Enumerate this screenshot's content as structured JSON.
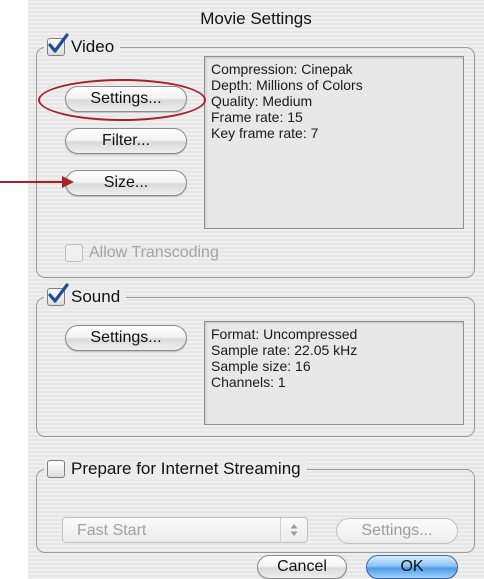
{
  "window": {
    "title": "Movie Settings"
  },
  "video": {
    "checkbox_label": "Video",
    "checked": true,
    "settings_button": "Settings...",
    "filter_button": "Filter...",
    "size_button": "Size...",
    "info_lines": [
      "Compression: Cinepak",
      "Depth: Millions of Colors",
      "Quality: Medium",
      "Frame rate: 15",
      "Key frame rate: 7"
    ],
    "allow_transcoding_label": "Allow Transcoding",
    "allow_transcoding_checked": false
  },
  "sound": {
    "checkbox_label": "Sound",
    "checked": true,
    "settings_button": "Settings...",
    "info_lines": [
      "Format: Uncompressed",
      "Sample rate: 22.05 kHz",
      "Sample size: 16",
      "Channels: 1"
    ]
  },
  "streaming": {
    "checkbox_label": "Prepare for Internet Streaming",
    "checked": false,
    "popup_value": "Fast Start",
    "settings_button": "Settings..."
  },
  "footer": {
    "cancel_button": "Cancel",
    "ok_button": "OK"
  },
  "colors": {
    "annotation": "#a8212a",
    "checkmark": "#1f4f9c",
    "ok_button": "#4f9be6"
  }
}
